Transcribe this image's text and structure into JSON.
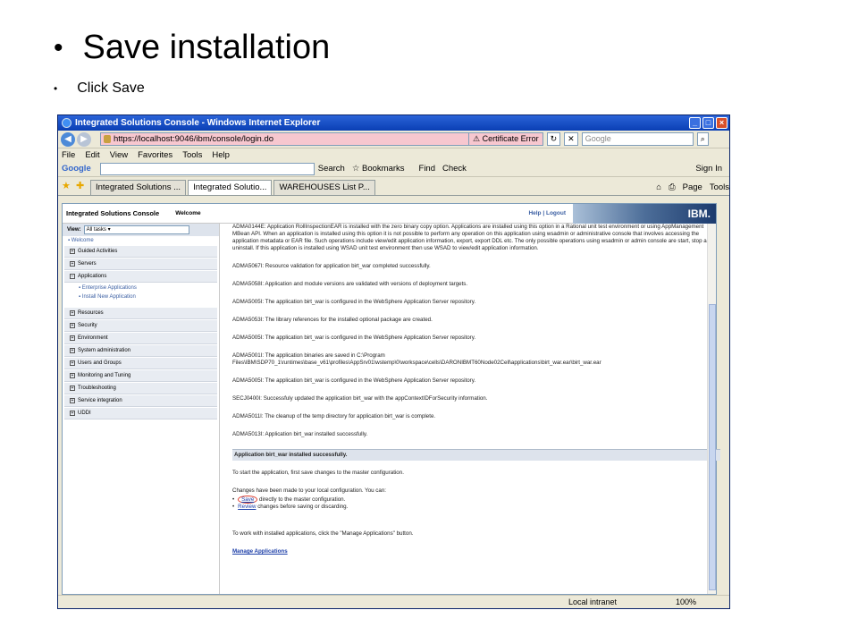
{
  "slide": {
    "title": "Save installation",
    "bullet": "Click Save"
  },
  "browser": {
    "window_title": "Integrated Solutions Console - Windows Internet Explorer",
    "url": "https://localhost:9046/ibm/console/login.do",
    "cert_error": "Certificate Error",
    "search_placeholder": "Google",
    "menu": [
      "File",
      "Edit",
      "View",
      "Favorites",
      "Tools",
      "Help"
    ],
    "google_bar": {
      "logo": "Google",
      "search_label": "Search",
      "bookmarks": "Bookmarks",
      "find": "Find",
      "check": "Check",
      "signin": "Sign In"
    },
    "tabs": [
      "Integrated Solutions ...",
      "Integrated Solutio...",
      "WAREHOUSES List P..."
    ],
    "tab_right": {
      "page": "Page",
      "tools": "Tools"
    },
    "status_zone": "Local intranet",
    "zoom": "100%"
  },
  "console": {
    "title": "Integrated Solutions Console",
    "welcome": "Welcome",
    "help": "Help",
    "logout": "Logout",
    "ibm": "IBM.",
    "view_label": "View:",
    "view_value": "All tasks",
    "nav": {
      "welcome": "Welcome",
      "guided": "Guided Activities",
      "servers": "Servers",
      "applications": "Applications",
      "enterprise_apps": "Enterprise Applications",
      "install_new": "Install New Application",
      "resources": "Resources",
      "security": "Security",
      "environment": "Environment",
      "sysadmin": "System administration",
      "users": "Users and Groups",
      "monitoring": "Monitoring and Tuning",
      "troubleshooting": "Troubleshooting",
      "service_integration": "Service integration",
      "uddi": "UDDI"
    },
    "messages": [
      "ADMA0144E: Application RollInspectionEAR is installed with the zero binary copy option. Applications are installed using this option in a Rational unit test environment or using AppManagement MBean API. When an application is installed using this option it is not possible to perform any operation on this application using wsadmin or administrative console that involves accessing the application metadata or EAR file. Such operations include view/edit application information, export, export DDL etc. The only possible operations using wsadmin or admin console are start, stop and uninstall. If this application is installed using WSAD unit test environment then use WSAD to view/edit application information.",
      "ADMA5067I: Resource validation for application birt_war completed successfully.",
      "ADMA5058I: Application and module versions are validated with versions of deployment targets.",
      "ADMA5005I: The application birt_war is configured in the WebSphere Application Server repository.",
      "ADMA5053I: The library references for the installed optional package are created.",
      "ADMA5005I: The application birt_war is configured in the WebSphere Application Server repository.",
      "ADMA5001I: The application binaries are saved in C:\\Program Files\\IBM\\SDP70_1\\runtimes\\base_v61\\profiles\\AppSrv01\\wstemp\\0\\workspace\\cells\\DARONIBMT60Node02Cell\\applications\\birt_war.ear\\birt_war.ear",
      "ADMA5005I: The application birt_war is configured in the WebSphere Application Server repository.",
      "SECJ0400I: Successfuly updated the application birt_war with the appContextIDForSecurity information.",
      "ADMA5011I: The cleanup of the temp directory for application birt_war is complete.",
      "ADMA5013I: Application birt_war installed successfully."
    ],
    "success_banner": "Application birt_war installed successfully.",
    "start_note": "To start the application, first save changes to the master configuration.",
    "changes_note": "Changes have been made to your local configuration. You can:",
    "save_link": "Save",
    "save_rest": "directly to the master configuration.",
    "review_link": "Review",
    "review_rest": "changes before saving or discarding.",
    "work_note": "To work with installed applications, click the \"Manage Applications\" button.",
    "manage_link": "Manage Applications"
  }
}
